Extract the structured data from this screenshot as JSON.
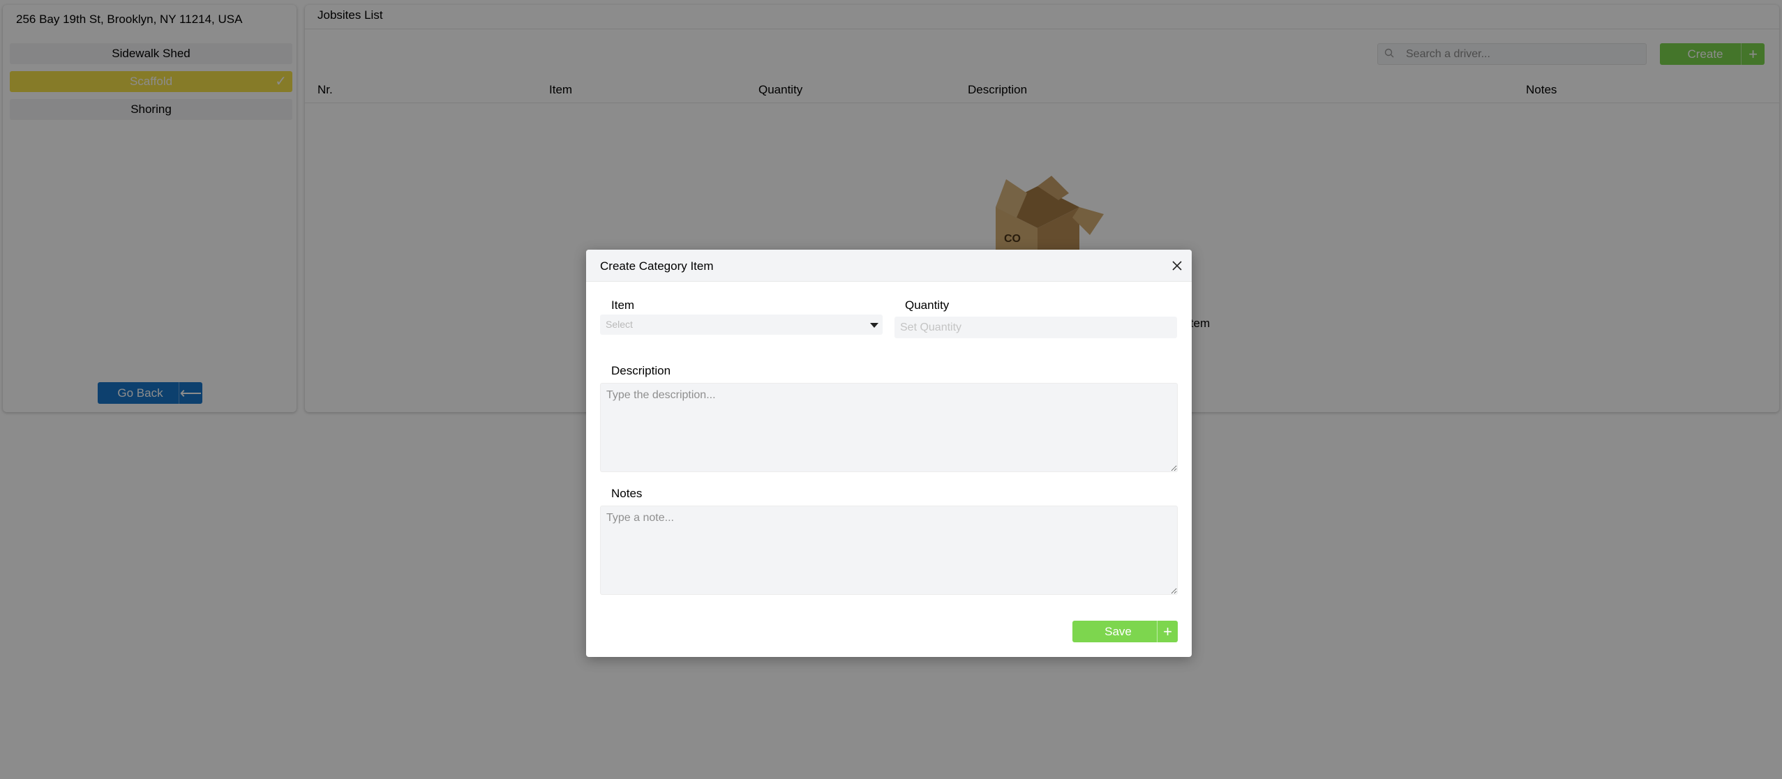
{
  "sidebar": {
    "address": "256 Bay 19th St, Brooklyn, NY 11214, USA",
    "categories": [
      {
        "label": "Sidewalk Shed",
        "selected": false
      },
      {
        "label": "Scaffold",
        "selected": true
      },
      {
        "label": "Shoring",
        "selected": false
      }
    ],
    "back_button": "Go Back",
    "colors": {
      "selected": "#f5e04a",
      "back_button": "#1876c8"
    }
  },
  "main": {
    "title": "Jobsites List",
    "search": {
      "placeholder": "Search a driver..."
    },
    "create_button": "Create",
    "columns": [
      "Nr.",
      "Item",
      "Quantity",
      "Description",
      "Notes"
    ],
    "empty_text": "item",
    "colors": {
      "create_button": "#7dd64e"
    }
  },
  "modal": {
    "title": "Create Category Item",
    "item_label": "Item",
    "item_placeholder": "Select",
    "quantity_label": "Quantity",
    "quantity_placeholder": "Set Quantity",
    "description_label": "Description",
    "description_placeholder": "Type the description...",
    "notes_label": "Notes",
    "notes_placeholder": "Type a note...",
    "save_button": "Save",
    "colors": {
      "save_button": "#7dd64e"
    }
  }
}
